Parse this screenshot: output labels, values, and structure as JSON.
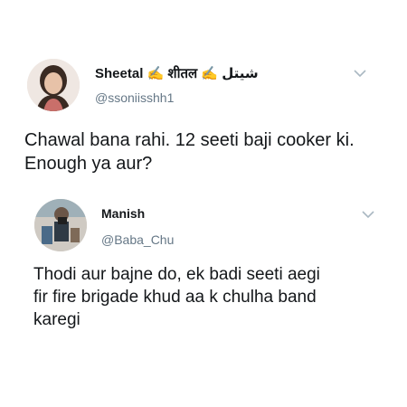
{
  "tweets": [
    {
      "display_name": "Sheetal ✍️ शीतल ✍️ شیتل",
      "handle": "@ssoniisshh1",
      "text": "Chawal bana rahi. 12 seeti baji cooker ki.\nEnough ya aur?",
      "menu_icon": "chevron-down-icon"
    },
    {
      "display_name": "Manish",
      "handle": "@Baba_Chu",
      "text": "Thodi aur bajne do, ek badi seeti aegi\nfir fire brigade khud aa k chulha band\nkaregi",
      "menu_icon": "chevron-down-icon"
    }
  ],
  "colors": {
    "text": "#14171a",
    "secondary": "#657786",
    "chevron": "#aab8c2",
    "background": "#ffffff"
  }
}
